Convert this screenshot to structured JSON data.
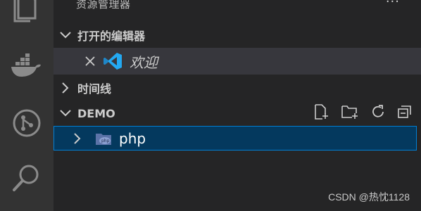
{
  "activity_bar": {
    "items": [
      {
        "icon": "files-icon"
      },
      {
        "icon": "docker-icon"
      },
      {
        "icon": "source-control-icon"
      },
      {
        "icon": "search-icon"
      }
    ]
  },
  "explorer": {
    "title": "资源管理器",
    "more": "···",
    "open_editors": {
      "label": "打开的编辑器",
      "items": [
        {
          "name": "欢迎",
          "icon": "vscode-icon"
        }
      ]
    },
    "timeline": {
      "label": "时间线"
    },
    "workspace": {
      "label": "DEMO",
      "actions": [
        "new-file-icon",
        "new-folder-icon",
        "refresh-icon",
        "collapse-all-icon"
      ],
      "items": [
        {
          "name": "php",
          "icon": "php-folder-icon"
        }
      ]
    }
  },
  "watermark": "CSDN @热忱1128",
  "colors": {
    "activity_bar": "#333333",
    "sidebar": "#252526",
    "selected_row": "#04395e",
    "focus_border": "#007fd4",
    "vscode_blue": "#23a9f2"
  }
}
